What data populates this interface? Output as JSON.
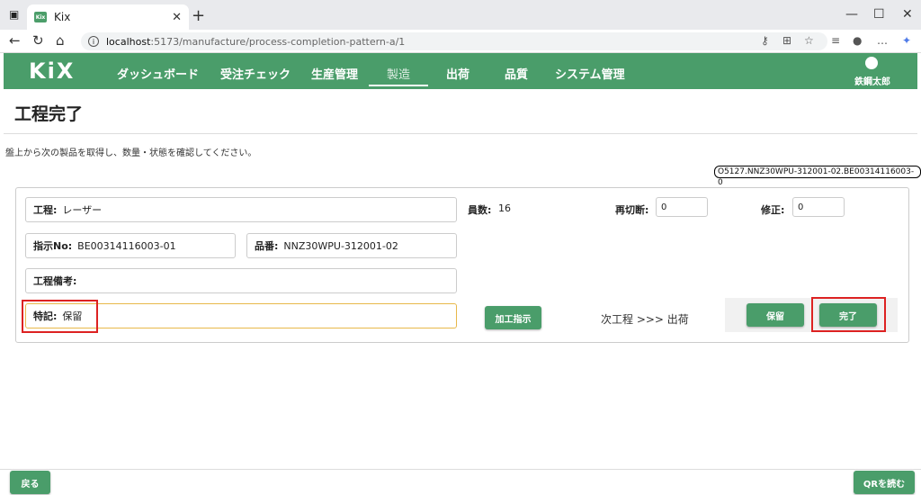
{
  "browser": {
    "tab_title": "Kix",
    "favicon_text": "Kix",
    "url_host": "localhost",
    "url_path": ":5173/manufacture/process-completion-pattern-a/1"
  },
  "app": {
    "logo": "KiX",
    "nav": [
      "ダッシュボード",
      "受注チェック",
      "生産管理",
      "製造",
      "出荷",
      "品質",
      "システム管理"
    ],
    "active_nav": "製造",
    "user_name": "鉄鋼太郎",
    "brand_color": "#4a9d6a"
  },
  "page": {
    "title": "工程完了",
    "instruction": "盤上から次の製品を取得し、数量・状態を確認してください。",
    "qr_readout": "O5127.NNZ30WPU-312001-02.BE00314116003-0"
  },
  "form": {
    "process_label": "工程:",
    "process_value": "レーザー",
    "instruction_no_label": "指示No:",
    "instruction_no_value": "BE00314116003-01",
    "part_no_label": "品番:",
    "part_no_value": "NNZ30WPU-312001-02",
    "process_note_label": "工程備考:",
    "process_note_value": "",
    "special_label": "特記:",
    "special_value": "保留",
    "count_label": "員数:",
    "count_value": "16",
    "recut_label": "再切断:",
    "recut_value": "0",
    "fix_label": "修正:",
    "fix_value": "0",
    "machining_button": "加工指示",
    "next_step": "次工程 >>> 出荷",
    "hold_button": "保留",
    "complete_button": "完了"
  },
  "footer": {
    "back_button": "戻る",
    "qr_button": "QRを読む"
  }
}
